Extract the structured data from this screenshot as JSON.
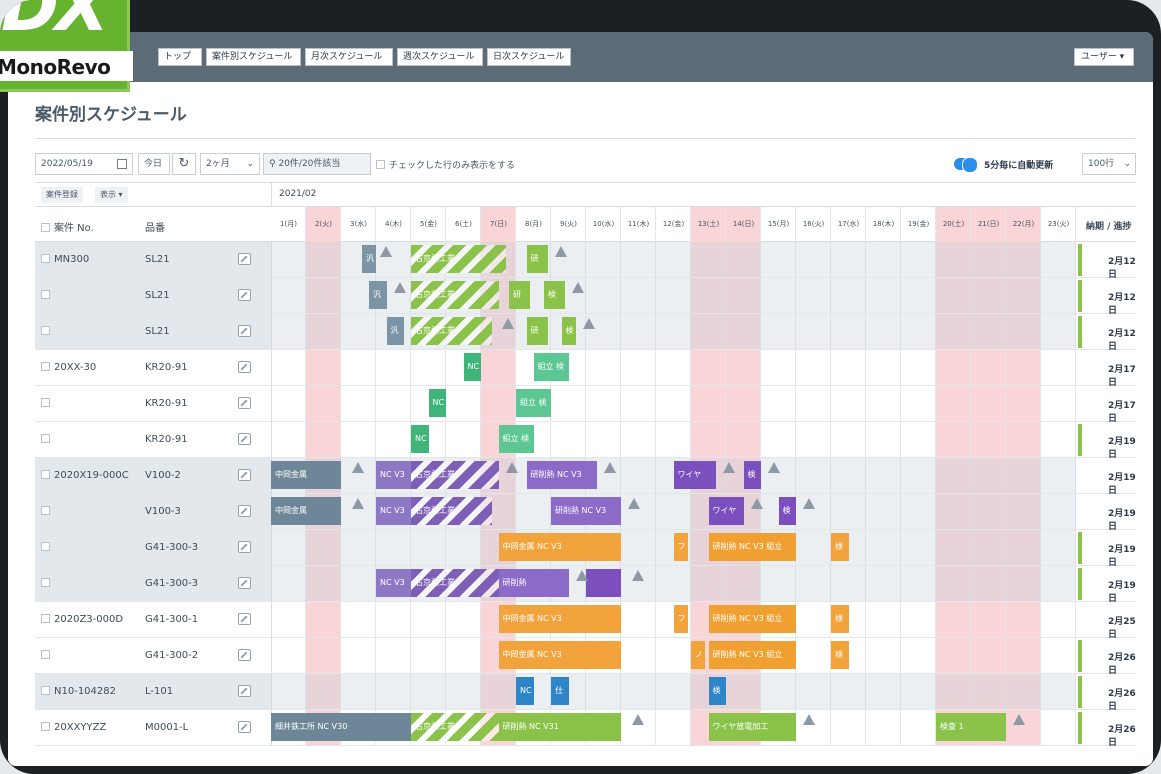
{
  "logo": {
    "mark": "DX",
    "brand": "MonoRevo"
  },
  "nav": {
    "items": [
      "トップ",
      "案件別スケジュール",
      "月次スケジュール",
      "週次スケジュール",
      "日次スケジュール"
    ],
    "user": "ユーザー ▾"
  },
  "page": {
    "title": "案件別スケジュール"
  },
  "toolbar": {
    "date_value": "2022/05/19",
    "today": "今日",
    "range": "2ヶ月",
    "search_result": "20件/20件該当",
    "checked_only": "チェックした行のみ表示をする",
    "auto_refresh": "5分毎に自動更新",
    "rows_per_page": "100行"
  },
  "grid": {
    "register_btn": "案件登録",
    "display_btn": "表示 ▾",
    "month_label": "2021/02",
    "col_case": "案件 No.",
    "col_part": "品番",
    "col_due": "納期 / 進捗",
    "days": [
      "1(月)",
      "2(火)",
      "3(水)",
      "4(木)",
      "5(金)",
      "6(土)",
      "7(日)",
      "8(月)",
      "9(火)",
      "10(水)",
      "11(木)",
      "12(金)",
      "13(土)",
      "14(日)",
      "15(月)",
      "16(火)",
      "17(水)",
      "18(木)",
      "19(金)",
      "20(土)",
      "21(日)",
      "22(月)",
      "23(火)"
    ],
    "holiday_idx": [
      1,
      6,
      12,
      13,
      19,
      20,
      21
    ],
    "rows": [
      {
        "case": "MN300",
        "part": "SL21",
        "due": "2月12日",
        "group": 1,
        "progress": "green"
      },
      {
        "case": "",
        "part": "SL21",
        "due": "2月12日",
        "group": 1,
        "progress": "green"
      },
      {
        "case": "",
        "part": "SL21",
        "due": "2月12日",
        "group": 1,
        "progress": "green"
      },
      {
        "case": "20XX-30",
        "part": "KR20-91",
        "due": "2月17日",
        "group": 0,
        "progress": "none"
      },
      {
        "case": "",
        "part": "KR20-91",
        "due": "2月17日",
        "group": 0,
        "progress": "none"
      },
      {
        "case": "",
        "part": "KR20-91",
        "due": "2月19日",
        "group": 0,
        "progress": "green"
      },
      {
        "case": "2020X19-000C",
        "part": "V100-2",
        "due": "2月19日",
        "group": 1,
        "progress": "none"
      },
      {
        "case": "",
        "part": "V100-3",
        "due": "2月19日",
        "group": 1,
        "progress": "none"
      },
      {
        "case": "",
        "part": "G41-300-3",
        "due": "2月19日",
        "group": 1,
        "progress": "green"
      },
      {
        "case": "",
        "part": "G41-300-3",
        "due": "2月19日",
        "group": 1,
        "progress": "green"
      },
      {
        "case": "2020Z3-000D",
        "part": "G41-300-1",
        "due": "2月25日",
        "group": 0,
        "progress": "none"
      },
      {
        "case": "",
        "part": "G41-300-2",
        "due": "2月26日",
        "group": 0,
        "progress": "green"
      },
      {
        "case": "N10-104282",
        "part": "L-101",
        "due": "2月26日",
        "group": 1,
        "progress": "green"
      },
      {
        "case": "20XXYYZZ",
        "part": "M0001-L",
        "due": "2月26日",
        "group": 0,
        "progress": "green"
      }
    ],
    "bars": [
      {
        "row": 0,
        "start": 2.6,
        "end": 3.0,
        "label": "汎",
        "color": "#7b95a6",
        "striped": false
      },
      {
        "row": 0,
        "start": 4.0,
        "end": 6.7,
        "label": "右京熱工業",
        "color": "#8bc34a",
        "striped": true
      },
      {
        "row": 0,
        "start": 7.3,
        "end": 7.9,
        "label": "研",
        "color": "#8bc34a",
        "striped": false
      },
      {
        "row": 1,
        "start": 2.8,
        "end": 3.3,
        "label": "汎",
        "color": "#7b95a6",
        "striped": false
      },
      {
        "row": 1,
        "start": 4.0,
        "end": 6.5,
        "label": "右京熱工業",
        "color": "#8bc34a",
        "striped": true
      },
      {
        "row": 1,
        "start": 6.8,
        "end": 7.4,
        "label": "研",
        "color": "#8bc34a",
        "striped": false
      },
      {
        "row": 1,
        "start": 7.8,
        "end": 8.4,
        "label": "検",
        "color": "#8bc34a",
        "striped": false
      },
      {
        "row": 2,
        "start": 3.3,
        "end": 3.8,
        "label": "汎",
        "color": "#7b95a6",
        "striped": false
      },
      {
        "row": 2,
        "start": 4.0,
        "end": 6.3,
        "label": "右京熱工業",
        "color": "#8bc34a",
        "striped": true
      },
      {
        "row": 2,
        "start": 7.3,
        "end": 7.9,
        "label": "研",
        "color": "#8bc34a",
        "striped": false
      },
      {
        "row": 2,
        "start": 8.3,
        "end": 8.7,
        "label": "検",
        "color": "#8bc34a",
        "striped": false
      },
      {
        "row": 3,
        "start": 5.5,
        "end": 6.0,
        "label": "NC",
        "color": "#3fb57a",
        "striped": false
      },
      {
        "row": 3,
        "start": 7.5,
        "end": 8.5,
        "label": "組立 検",
        "color": "#5cc793",
        "striped": false
      },
      {
        "row": 4,
        "start": 4.5,
        "end": 5.0,
        "label": "NC",
        "color": "#3fb57a",
        "striped": false
      },
      {
        "row": 4,
        "start": 7.0,
        "end": 8.0,
        "label": "組立 検",
        "color": "#5cc793",
        "striped": false
      },
      {
        "row": 5,
        "start": 4.0,
        "end": 4.5,
        "label": "NC",
        "color": "#3fb57a",
        "striped": false
      },
      {
        "row": 5,
        "start": 6.5,
        "end": 7.5,
        "label": "組立 検",
        "color": "#5cc793",
        "striped": false
      },
      {
        "row": 6,
        "start": 0.0,
        "end": 2.0,
        "label": "中岡金属",
        "color": "#6d8798",
        "striped": false
      },
      {
        "row": 6,
        "start": 3.0,
        "end": 4.0,
        "label": "NC V3",
        "color": "#8c78c4",
        "striped": false
      },
      {
        "row": 6,
        "start": 4.0,
        "end": 6.5,
        "label": "右京熱工業",
        "color": "#7e5fb8",
        "striped": true
      },
      {
        "row": 6,
        "start": 7.3,
        "end": 9.3,
        "label": "研削熱 NC V3",
        "color": "#8c6ac8",
        "striped": false
      },
      {
        "row": 6,
        "start": 11.5,
        "end": 12.7,
        "label": "ワイヤ",
        "color": "#7b4fbd",
        "striped": false
      },
      {
        "row": 6,
        "start": 13.5,
        "end": 14.0,
        "label": "検",
        "color": "#7b4fbd",
        "striped": false
      },
      {
        "row": 7,
        "start": 0.0,
        "end": 2.0,
        "label": "中岡金属",
        "color": "#6d8798",
        "striped": false
      },
      {
        "row": 7,
        "start": 3.0,
        "end": 4.0,
        "label": "NC V3",
        "color": "#8c78c4",
        "striped": false
      },
      {
        "row": 7,
        "start": 4.0,
        "end": 6.3,
        "label": "右京熱工業",
        "color": "#7e5fb8",
        "striped": true
      },
      {
        "row": 7,
        "start": 8.0,
        "end": 10.0,
        "label": "研削熱 NC V3",
        "color": "#8c6ac8",
        "striped": false
      },
      {
        "row": 7,
        "start": 12.5,
        "end": 13.5,
        "label": "ワイヤ",
        "color": "#7b4fbd",
        "striped": false
      },
      {
        "row": 7,
        "start": 14.5,
        "end": 15.0,
        "label": "検",
        "color": "#7b4fbd",
        "striped": false
      },
      {
        "row": 8,
        "start": 6.5,
        "end": 10.0,
        "label": "中岡金属          NC V3",
        "color": "#f2a33c",
        "striped": false
      },
      {
        "row": 8,
        "start": 11.5,
        "end": 11.9,
        "label": "フ",
        "color": "#f2a33c",
        "striped": false
      },
      {
        "row": 8,
        "start": 12.5,
        "end": 15.0,
        "label": "研削熱 NC V3 組立",
        "color": "#f0a030",
        "striped": false
      },
      {
        "row": 8,
        "start": 16.0,
        "end": 16.5,
        "label": "検",
        "color": "#f2a33c",
        "striped": false
      },
      {
        "row": 9,
        "start": 3.0,
        "end": 4.0,
        "label": "NC V3",
        "color": "#8c78c4",
        "striped": false
      },
      {
        "row": 9,
        "start": 4.0,
        "end": 6.5,
        "label": "右京熱工業",
        "color": "#7e5fb8",
        "striped": true
      },
      {
        "row": 9,
        "start": 6.5,
        "end": 8.5,
        "label": "研削熱",
        "color": "#8c6ac8",
        "striped": false
      },
      {
        "row": 9,
        "start": 9.0,
        "end": 10.0,
        "label": "",
        "color": "#7b4fbd",
        "striped": false
      },
      {
        "row": 10,
        "start": 6.5,
        "end": 10.0,
        "label": "中岡金属          NC V3",
        "color": "#f2a33c",
        "striped": false
      },
      {
        "row": 10,
        "start": 11.5,
        "end": 11.9,
        "label": "フ",
        "color": "#f2a33c",
        "striped": false
      },
      {
        "row": 10,
        "start": 12.5,
        "end": 15.0,
        "label": "研削熱 NC V3 組立",
        "color": "#f0a030",
        "striped": false
      },
      {
        "row": 10,
        "start": 16.0,
        "end": 16.5,
        "label": "検",
        "color": "#f2a33c",
        "striped": false
      },
      {
        "row": 11,
        "start": 6.5,
        "end": 10.0,
        "label": "中岡金属          NC V3",
        "color": "#f2a33c",
        "striped": false
      },
      {
        "row": 11,
        "start": 12.0,
        "end": 12.4,
        "label": "ノ",
        "color": "#f2a33c",
        "striped": false
      },
      {
        "row": 11,
        "start": 12.5,
        "end": 15.0,
        "label": "研削熱 NC V3 組立",
        "color": "#f0a030",
        "striped": false
      },
      {
        "row": 11,
        "start": 16.0,
        "end": 16.5,
        "label": "検",
        "color": "#f2a33c",
        "striped": false
      },
      {
        "row": 12,
        "start": 7.0,
        "end": 7.5,
        "label": "NC",
        "color": "#2e86c9",
        "striped": false
      },
      {
        "row": 12,
        "start": 8.0,
        "end": 8.5,
        "label": "仕",
        "color": "#2e86c9",
        "striped": false
      },
      {
        "row": 12,
        "start": 12.5,
        "end": 13.0,
        "label": "検",
        "color": "#2e86c9",
        "striped": false
      },
      {
        "row": 13,
        "start": 0.0,
        "end": 4.0,
        "label": "細井鉄工所    NC V30",
        "color": "#6d8798",
        "striped": false
      },
      {
        "row": 13,
        "start": 4.0,
        "end": 6.5,
        "label": "右京熱工業",
        "color": "#8bc34a",
        "striped": true
      },
      {
        "row": 13,
        "start": 6.5,
        "end": 10.0,
        "label": "研削熱          NC V31",
        "color": "#8bc34a",
        "striped": false
      },
      {
        "row": 13,
        "start": 12.5,
        "end": 15.0,
        "label": "ワイヤ放電加工",
        "color": "#8bc34a",
        "striped": false
      },
      {
        "row": 13,
        "start": 19.0,
        "end": 21.0,
        "label": "検査 1",
        "color": "#8bc34a",
        "striped": false
      }
    ],
    "warnings": [
      {
        "row": 0,
        "at": 3.1
      },
      {
        "row": 0,
        "at": 8.1
      },
      {
        "row": 1,
        "at": 3.5
      },
      {
        "row": 1,
        "at": 8.6
      },
      {
        "row": 2,
        "at": 6.6
      },
      {
        "row": 2,
        "at": 8.9
      },
      {
        "row": 6,
        "at": 2.3
      },
      {
        "row": 6,
        "at": 6.7
      },
      {
        "row": 6,
        "at": 9.5
      },
      {
        "row": 6,
        "at": 12.9
      },
      {
        "row": 6,
        "at": 14.2
      },
      {
        "row": 7,
        "at": 2.3
      },
      {
        "row": 7,
        "at": 10.2
      },
      {
        "row": 7,
        "at": 13.7
      },
      {
        "row": 7,
        "at": 15.2
      },
      {
        "row": 9,
        "at": 8.7
      },
      {
        "row": 9,
        "at": 10.3
      },
      {
        "row": 13,
        "at": 10.3
      },
      {
        "row": 13,
        "at": 15.2
      },
      {
        "row": 13,
        "at": 21.2
      }
    ]
  },
  "colors": {
    "holiday": "#f9d5d8",
    "greyband": "#e3e8ed",
    "progress_green": "#8bc34a"
  }
}
